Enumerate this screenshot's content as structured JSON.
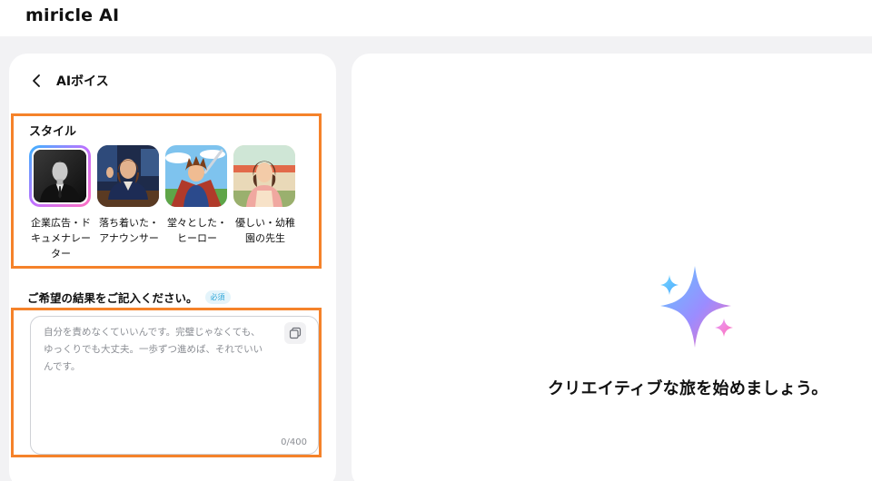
{
  "app": {
    "logo_text": "miricle AI"
  },
  "panel": {
    "back_icon": "chevron-left-icon",
    "title": "AIボイス"
  },
  "styles": {
    "label": "スタイル",
    "items": [
      {
        "caption": "企業広告・ドキュメナレーター",
        "selected": true
      },
      {
        "caption": "落ち着いた・アナウンサー",
        "selected": false
      },
      {
        "caption": "堂々とした・ヒーロー",
        "selected": false
      },
      {
        "caption": "優しい・幼稚園の先生",
        "selected": false
      }
    ]
  },
  "description": {
    "label": "ご希望の結果をご記入ください。",
    "required_badge": "必須",
    "value": "自分を責めなくていいんです。完璧じゃなくても、ゆっくりでも大丈夫。一歩ずつ進めば、それでいいんです。",
    "counter": "0/400",
    "copy_icon": "copy-icon"
  },
  "output": {
    "sparkle_icon": "sparkle-icon",
    "empty_message": "クリエイティブな旅を始めましょう。"
  },
  "colors": {
    "highlight": "#f5822a",
    "badge": "#2fa6d8",
    "background": "#f2f2f4"
  }
}
